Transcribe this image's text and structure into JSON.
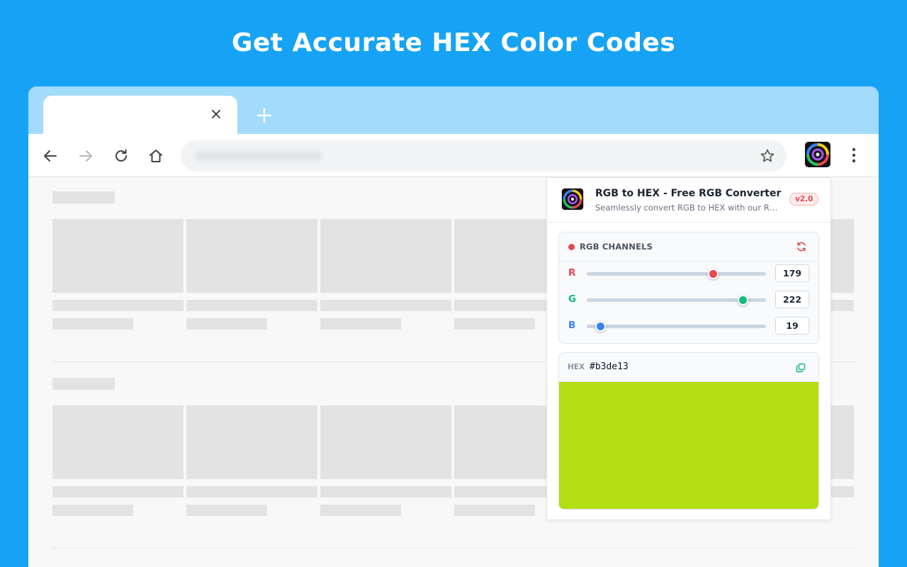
{
  "headline": "Get Accurate HEX Color Codes",
  "colors": {
    "background": "#16a3f5",
    "red_channel": "#e5484d",
    "green_channel": "#10b981",
    "blue_channel": "#3b82f6",
    "swatch": "#b3de13"
  },
  "browser": {
    "tab": {
      "close_icon": "close-icon"
    },
    "new_tab_icon": "plus-icon",
    "toolbar": {
      "back_icon": "arrow-left-icon",
      "forward_icon": "arrow-right-icon",
      "reload_icon": "reload-icon",
      "home_icon": "home-icon",
      "bookmark_icon": "star-icon",
      "menu_icon": "kebab-menu-icon"
    }
  },
  "popup": {
    "title": "RGB to HEX - Free RGB Converter",
    "subtitle": "Seamlessly convert RGB to HEX with our RGB to HEX converter",
    "version": "v2.0",
    "rgb_card": {
      "title": "RGB CHANNELS",
      "channels": [
        {
          "label": "R",
          "value": "179",
          "fraction": 0.702
        },
        {
          "label": "G",
          "value": "222",
          "fraction": 0.871
        },
        {
          "label": "B",
          "value": "19",
          "fraction": 0.075
        }
      ]
    },
    "hex_card": {
      "label": "HEX",
      "value": "#b3de13"
    }
  }
}
